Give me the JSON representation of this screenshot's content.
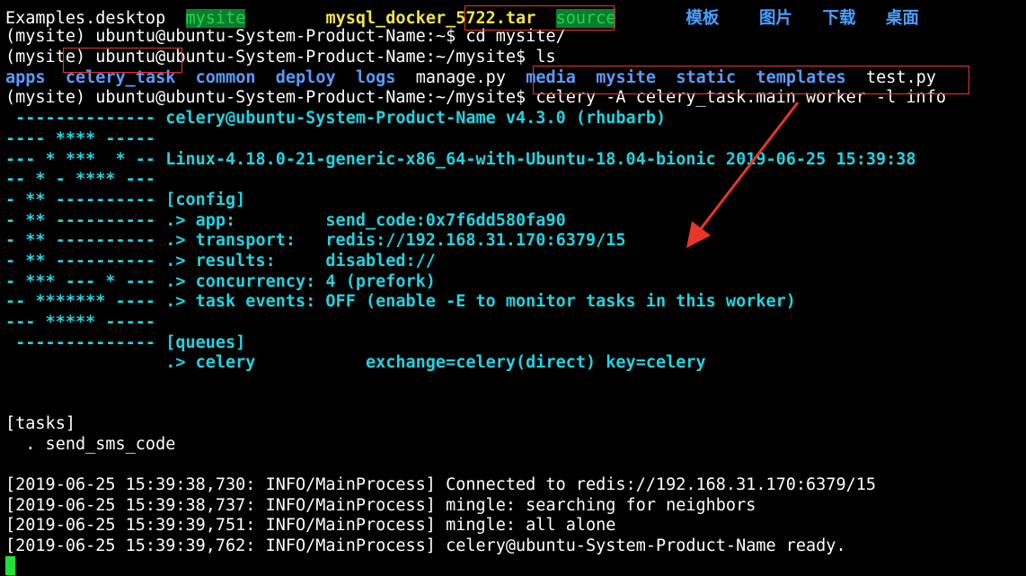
{
  "top": {
    "file1": "Examples.desktop",
    "dir1": "mysite",
    "file2": "mysql_docker_5722.tar",
    "dir2": "source",
    "cn1": "模板",
    "cn2": "图片",
    "cn3": "下载",
    "cn4": "桌面"
  },
  "prompt1": {
    "prefix": "(mysite) ubuntu@ubuntu-System-Product-Name:~$ ",
    "command": "cd mysite/"
  },
  "prompt2": {
    "prefix": "(mysite) ubuntu@ubuntu-System-Product-Name:~/mysite$ ",
    "command": "ls"
  },
  "ls": {
    "apps": "apps",
    "celery_task": "celery_task",
    "common": "common",
    "deploy": "deploy",
    "logs": "logs",
    "manage": "manage.py",
    "media": "media",
    "mysite": "mysite",
    "static": "static",
    "templates": "templates",
    "test": "test.py"
  },
  "prompt3": {
    "prefix": "(mysite) ubuntu@ubuntu-System-Product-Name:~/mysite$ ",
    "command": "celery -A celery_task.main worker -l info"
  },
  "banner": {
    "l1": " -------------- celery@ubuntu-System-Product-Name v4.3.0 (rhubarb)",
    "l2": "---- **** -----",
    "l3": "--- * ***  * -- Linux-4.18.0-21-generic-x86_64-with-Ubuntu-18.04-bionic 2019-06-25 15:39:38",
    "l4": "-- * - **** ---",
    "l5": "- ** ---------- [config]",
    "l6": "- ** ---------- .> app:         send_code:0x7f6dd580fa90",
    "l7": "- ** ---------- .> transport:   redis://192.168.31.170:6379/15",
    "l8": "- ** ---------- .> results:     disabled://",
    "l9": "- *** --- * --- .> concurrency: 4 (prefork)",
    "l10": "-- ******* ---- .> task events: OFF (enable -E to monitor tasks in this worker)",
    "l11": "--- ***** -----",
    "l12": " -------------- [queues]",
    "l13": "                .> celery           exchange=celery(direct) key=celery"
  },
  "tasks": {
    "header": "[tasks]",
    "item": "  . send_sms_code"
  },
  "logs": [
    "[2019-06-25 15:39:38,730: INFO/MainProcess] Connected to redis://192.168.31.170:6379/15",
    "[2019-06-25 15:39:38,737: INFO/MainProcess] mingle: searching for neighbors",
    "[2019-06-25 15:39:39,751: INFO/MainProcess] mingle: all alone",
    "[2019-06-25 15:39:39,762: INFO/MainProcess] celery@ubuntu-System-Product-Name ready."
  ],
  "colors": {
    "annotation": "#e8352b",
    "cyan_output": "#22d3e0",
    "dir_blue": "#5a9cff",
    "cursor": "#22e03a"
  }
}
